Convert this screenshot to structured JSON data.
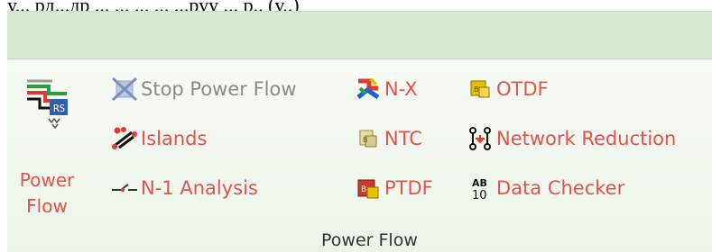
{
  "top_text": "у... рд...др ...  ...  ... ...  ...руу ... р.. (у..)",
  "group": {
    "label": "Power Flow"
  },
  "big_button": {
    "label_line1": "Power",
    "label_line2": "Flow",
    "icon": "power-flow-icon"
  },
  "col1": [
    {
      "id": "stop-power-flow",
      "label": "Stop Power Flow",
      "icon": "stop-power-flow-icon",
      "enabled": false
    },
    {
      "id": "islands",
      "label": "Islands",
      "icon": "islands-icon",
      "enabled": true
    },
    {
      "id": "n1-analysis",
      "label": "N-1 Analysis",
      "icon": "n1-analysis-icon",
      "enabled": true
    }
  ],
  "col2": [
    {
      "id": "nx",
      "label": "N-X",
      "icon": "nx-icon"
    },
    {
      "id": "ntc",
      "label": "NTC",
      "icon": "ntc-icon"
    },
    {
      "id": "ptdf",
      "label": "PTDF",
      "icon": "ptdf-icon"
    }
  ],
  "col3": [
    {
      "id": "otdf",
      "label": "OTDF",
      "icon": "otdf-icon"
    },
    {
      "id": "network-reduction",
      "label": "Network Reduction",
      "icon": "network-reduction-icon"
    },
    {
      "id": "data-checker",
      "label": "Data Checker",
      "icon": "data-checker-icon"
    }
  ],
  "colors": {
    "accent_red": "#e2534b",
    "disabled_gray": "#8a8a8a",
    "ribbon_bg": "#eef6eb"
  }
}
